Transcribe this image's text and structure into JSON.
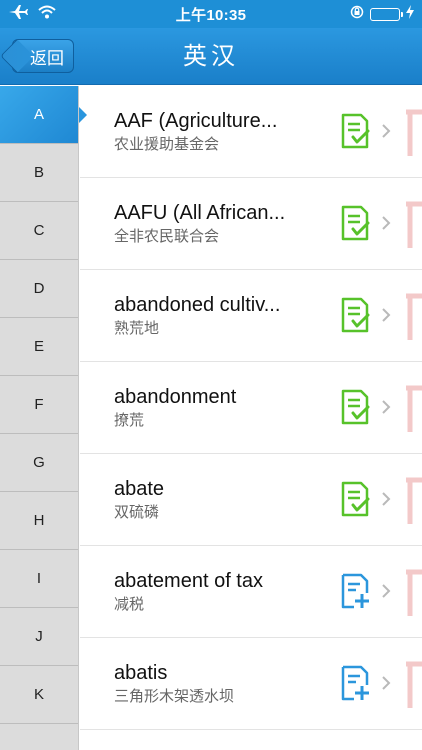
{
  "status_bar": {
    "time": "上午10:35",
    "icons": [
      "airplane-mode-icon",
      "wifi-icon",
      "rotation-lock-icon",
      "battery-icon",
      "charging-icon"
    ]
  },
  "nav": {
    "back_label": "返回",
    "title": "英汉"
  },
  "sidebar": {
    "letters": [
      "A",
      "B",
      "C",
      "D",
      "E",
      "F",
      "G",
      "H",
      "I",
      "J",
      "K"
    ],
    "active": "A"
  },
  "list": {
    "items": [
      {
        "title": "AAF (Agriculture...",
        "subtitle": "农业援助基金会",
        "icon": "added-note-icon",
        "icon_color": "#57c22a"
      },
      {
        "title": "AAFU (All African...",
        "subtitle": "全非农民联合会",
        "icon": "added-note-icon",
        "icon_color": "#57c22a"
      },
      {
        "title": "abandoned cultiv...",
        "subtitle": "熟荒地",
        "icon": "added-note-icon",
        "icon_color": "#57c22a"
      },
      {
        "title": "abandonment",
        "subtitle": "撩荒",
        "icon": "added-note-icon",
        "icon_color": "#57c22a"
      },
      {
        "title": "abate",
        "subtitle": "双硫磷",
        "icon": "added-note-icon",
        "icon_color": "#57c22a"
      },
      {
        "title": "abatement of tax",
        "subtitle": "减税",
        "icon": "add-note-icon",
        "icon_color": "#2b96dc"
      },
      {
        "title": "abatis",
        "subtitle": "三角形木架透水坝",
        "icon": "add-note-icon",
        "icon_color": "#2b96dc"
      }
    ]
  },
  "colors": {
    "accent": "#1e8fd6",
    "added": "#57c22a",
    "add": "#2b96dc",
    "edge_mark": "#f3c9c9"
  }
}
